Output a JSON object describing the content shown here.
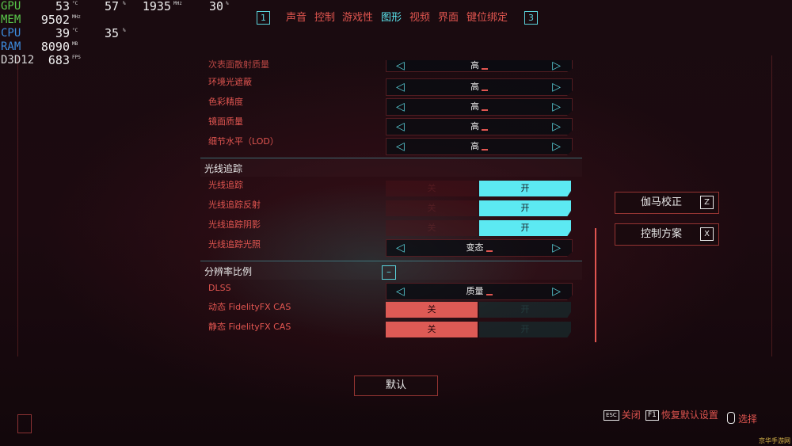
{
  "hud": {
    "gpu": {
      "label": "GPU",
      "value": "53",
      "unit": "°C",
      "load": "57",
      "load_unit": "%",
      "clock": "1935",
      "clock_unit": "MHz",
      "extra": "30",
      "extra_unit": "%"
    },
    "mem": {
      "label": "MEM",
      "value": "9502",
      "unit": "MHz"
    },
    "cpu": {
      "label": "CPU",
      "value": "39",
      "unit": "°C",
      "load": "35",
      "load_unit": "%"
    },
    "ram": {
      "label": "RAM",
      "value": "8090",
      "unit": "MB"
    },
    "api": {
      "label": "D3D12",
      "value": "683",
      "unit": "FPS"
    },
    "colors": {
      "gpu": "#59c84a",
      "mem": "#59c84a",
      "cpu": "#3d8de0",
      "ram": "#3d8de0",
      "api": "#d8d8d8"
    }
  },
  "nav": {
    "left_key": "1",
    "right_key": "3",
    "tabs": [
      "声音",
      "控制",
      "游戏性",
      "图形",
      "视频",
      "界面",
      "键位绑定"
    ],
    "active": "图形"
  },
  "settings": {
    "partial_row": {
      "label": "次表面散射质量",
      "value": "高"
    },
    "rows_top": [
      {
        "label": "环境光遮蔽",
        "value": "高"
      },
      {
        "label": "色彩精度",
        "value": "高"
      },
      {
        "label": "镜面质量",
        "value": "高"
      },
      {
        "label": "细节水平（LOD）",
        "value": "高"
      }
    ],
    "raytracing": {
      "title": "光线追踪",
      "toggles": [
        {
          "label": "光线追踪",
          "off": "关",
          "on": "开"
        },
        {
          "label": "光线追踪反射",
          "off": "关",
          "on": "开"
        },
        {
          "label": "光线追踪阴影",
          "off": "关",
          "on": "开"
        }
      ],
      "lighting": {
        "label": "光线追踪光照",
        "value": "变态"
      }
    },
    "resolution": {
      "title": "分辨率比例",
      "collapse_symbol": "–",
      "dlss": {
        "label": "DLSS",
        "value": "质量"
      },
      "dynamic_cas": {
        "label": "动态 FidelityFX CAS",
        "off": "关",
        "on": "开"
      },
      "static_cas": {
        "label": "静态 FidelityFX CAS",
        "off": "关",
        "on": "开"
      }
    },
    "arrow_left": "◁",
    "arrow_right": "▷"
  },
  "side": {
    "gamma": {
      "label": "伽马校正",
      "key": "Z"
    },
    "scheme": {
      "label": "控制方案",
      "key": "X"
    }
  },
  "default_button": "默认",
  "footer": {
    "close": {
      "key": "ESC",
      "label": "关闭"
    },
    "restore": {
      "key": "F1",
      "label": "恢复默认设置"
    },
    "select": {
      "label": "选择"
    }
  },
  "watermark": "京华手游网",
  "accent": "#5ce9f2",
  "primary": "#e05550"
}
